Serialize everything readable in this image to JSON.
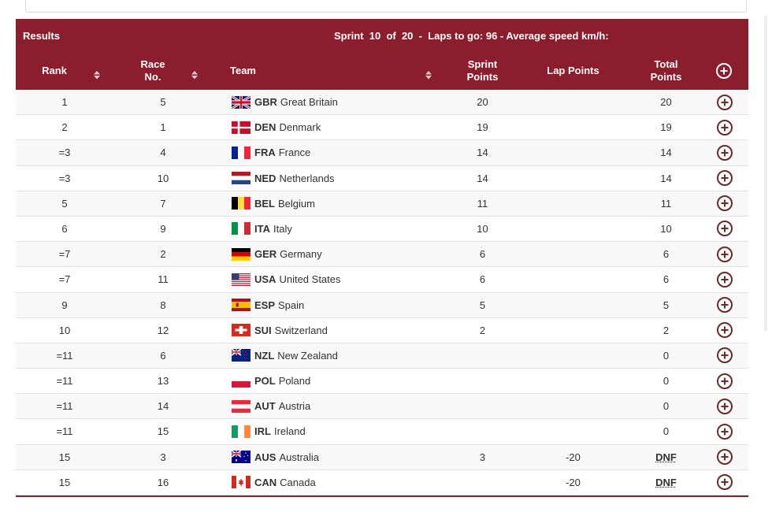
{
  "header": {
    "results_label": "Results",
    "sprint_info": "Sprint  10  of  20  -  Laps to go: 96 - Average speed km/h:"
  },
  "columns": {
    "rank": "Rank",
    "race_no": "Race\nNo.",
    "team": "Team",
    "sprint_points": "Sprint\nPoints",
    "lap_points": "Lap Points",
    "total_points": "Total\nPoints"
  },
  "colors": {
    "accent": "#8b1e2d"
  },
  "rows": [
    {
      "rank": "1",
      "race": "5",
      "flag": "gbr",
      "noc": "GBR",
      "country": "Great Britain",
      "sprint": "20",
      "lap": "",
      "total": "20",
      "dnf": false
    },
    {
      "rank": "2",
      "race": "1",
      "flag": "den",
      "noc": "DEN",
      "country": "Denmark",
      "sprint": "19",
      "lap": "",
      "total": "19",
      "dnf": false
    },
    {
      "rank": "=3",
      "race": "4",
      "flag": "fra",
      "noc": "FRA",
      "country": "France",
      "sprint": "14",
      "lap": "",
      "total": "14",
      "dnf": false
    },
    {
      "rank": "=3",
      "race": "10",
      "flag": "ned",
      "noc": "NED",
      "country": "Netherlands",
      "sprint": "14",
      "lap": "",
      "total": "14",
      "dnf": false
    },
    {
      "rank": "5",
      "race": "7",
      "flag": "bel",
      "noc": "BEL",
      "country": "Belgium",
      "sprint": "11",
      "lap": "",
      "total": "11",
      "dnf": false
    },
    {
      "rank": "6",
      "race": "9",
      "flag": "ita",
      "noc": "ITA",
      "country": "Italy",
      "sprint": "10",
      "lap": "",
      "total": "10",
      "dnf": false
    },
    {
      "rank": "=7",
      "race": "2",
      "flag": "ger",
      "noc": "GER",
      "country": "Germany",
      "sprint": "6",
      "lap": "",
      "total": "6",
      "dnf": false
    },
    {
      "rank": "=7",
      "race": "11",
      "flag": "usa",
      "noc": "USA",
      "country": "United States",
      "sprint": "6",
      "lap": "",
      "total": "6",
      "dnf": false
    },
    {
      "rank": "9",
      "race": "8",
      "flag": "esp",
      "noc": "ESP",
      "country": "Spain",
      "sprint": "5",
      "lap": "",
      "total": "5",
      "dnf": false
    },
    {
      "rank": "10",
      "race": "12",
      "flag": "sui",
      "noc": "SUI",
      "country": "Switzerland",
      "sprint": "2",
      "lap": "",
      "total": "2",
      "dnf": false
    },
    {
      "rank": "=11",
      "race": "6",
      "flag": "nzl",
      "noc": "NZL",
      "country": "New Zealand",
      "sprint": "",
      "lap": "",
      "total": "0",
      "dnf": false
    },
    {
      "rank": "=11",
      "race": "13",
      "flag": "pol",
      "noc": "POL",
      "country": "Poland",
      "sprint": "",
      "lap": "",
      "total": "0",
      "dnf": false
    },
    {
      "rank": "=11",
      "race": "14",
      "flag": "aut",
      "noc": "AUT",
      "country": "Austria",
      "sprint": "",
      "lap": "",
      "total": "0",
      "dnf": false
    },
    {
      "rank": "=11",
      "race": "15",
      "flag": "irl",
      "noc": "IRL",
      "country": "Ireland",
      "sprint": "",
      "lap": "",
      "total": "0",
      "dnf": false
    },
    {
      "rank": "15",
      "race": "3",
      "flag": "aus",
      "noc": "AUS",
      "country": "Australia",
      "sprint": "3",
      "lap": "-20",
      "total": "DNF",
      "dnf": true
    },
    {
      "rank": "15",
      "race": "16",
      "flag": "can",
      "noc": "CAN",
      "country": "Canada",
      "sprint": "",
      "lap": "-20",
      "total": "DNF",
      "dnf": true
    }
  ]
}
